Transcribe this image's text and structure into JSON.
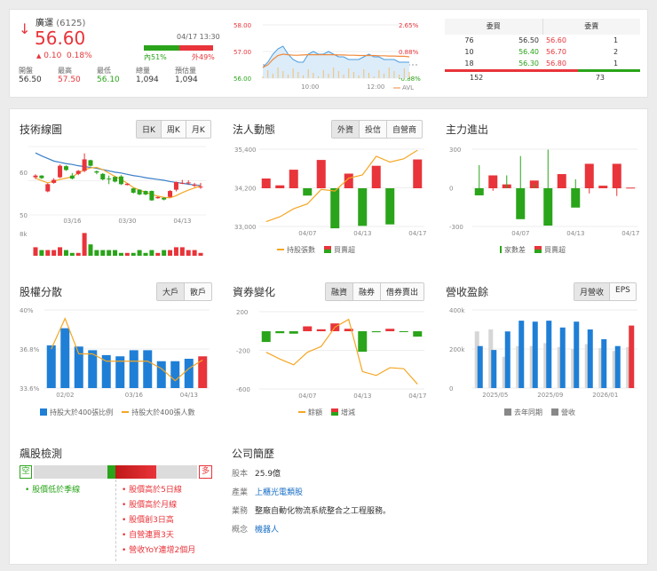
{
  "quote": {
    "name": "廣運",
    "code": "(6125)",
    "price": "56.60",
    "change": "0.10",
    "change_pct": "0.18%",
    "time": "04/17 13:30",
    "inner": "內51%",
    "outer": "外49%",
    "inner_frac": 0.51,
    "stats": [
      {
        "label": "開盤",
        "value": "56.50",
        "color": "#333"
      },
      {
        "label": "最高",
        "value": "57.50",
        "color": "#e8343a"
      },
      {
        "label": "最低",
        "value": "56.10",
        "color": "#2aa41a"
      },
      {
        "label": "總量",
        "value": "1,094",
        "color": "#333"
      },
      {
        "label": "預估量",
        "value": "1,094",
        "color": "#333"
      }
    ]
  },
  "intraday": {
    "y_left": [
      "58.00",
      "57.00",
      "56.00"
    ],
    "y_right": [
      "2.65%",
      "0.88%",
      "-0.88%"
    ],
    "x": [
      "10:00",
      "12:00"
    ],
    "legend": "AVL",
    "price": [
      56.4,
      56.6,
      56.9,
      57.1,
      57.2,
      56.9,
      56.7,
      56.6,
      56.6,
      56.9,
      57.0,
      56.9,
      56.9,
      57.0,
      56.9,
      56.8,
      56.8,
      56.7,
      56.7,
      56.7,
      56.8,
      56.9,
      56.8,
      56.8,
      56.7,
      56.7,
      56.7,
      56.6,
      56.6,
      56.6
    ],
    "avg": [
      56.4,
      56.5,
      56.7,
      56.85,
      56.9,
      56.88,
      56.86,
      56.86,
      56.87,
      56.88,
      56.88,
      56.88,
      56.88,
      56.88,
      56.88,
      56.87,
      56.87,
      56.86,
      56.86,
      56.85,
      56.85,
      56.85,
      56.85,
      56.84,
      56.84,
      56.83,
      56.83,
      56.82,
      56.82,
      56.8
    ]
  },
  "orderbook": {
    "bid_header": "委買",
    "ask_header": "委賣",
    "rows": [
      {
        "bid_vol": "76",
        "bid": "56.50",
        "ask": "56.60",
        "ask_vol": "1"
      },
      {
        "bid_vol": "10",
        "bid": "56.40",
        "ask": "56.70",
        "ask_vol": "2"
      },
      {
        "bid_vol": "18",
        "bid": "56.30",
        "ask": "56.80",
        "ask_vol": "1"
      }
    ],
    "bid_total": "152",
    "ask_total": "73",
    "bid_frac": 0.68
  },
  "tech": {
    "title": "技術線圖",
    "tabs": [
      "日K",
      "周K",
      "月K"
    ],
    "y_labels": [
      "60",
      "50"
    ],
    "x_labels": [
      "03/16",
      "03/30",
      "04/13"
    ],
    "vol_label": "8k",
    "candles": [
      [
        58.8,
        59.2,
        59.5,
        58.4
      ],
      [
        59.2,
        58.6,
        59.3,
        58.4
      ],
      [
        55.5,
        57.2,
        57.4,
        55.3
      ],
      [
        57.5,
        58.2,
        58.6,
        57.3
      ],
      [
        58.8,
        61.5,
        61.8,
        58.6
      ],
      [
        61.4,
        60.5,
        61.6,
        60.3
      ],
      [
        59.2,
        58.5,
        59.8,
        58.3
      ],
      [
        59.6,
        60.3,
        60.5,
        59.3
      ],
      [
        60.3,
        63.0,
        64.4,
        60.0
      ],
      [
        62.8,
        61.5,
        62.9,
        61.3
      ],
      [
        60.2,
        59.9,
        60.4,
        59.5
      ],
      [
        59.6,
        58.3,
        59.8,
        58.1
      ],
      [
        58.5,
        58.4,
        59.2,
        57.2
      ],
      [
        58.9,
        57.8,
        59.0,
        57.6
      ],
      [
        59.0,
        57.2,
        59.3,
        57.0
      ],
      [
        57.0,
        57.3,
        57.4,
        56.9
      ],
      [
        56.2,
        55.2,
        56.3,
        55.0
      ],
      [
        55.9,
        54.8,
        56.0,
        54.6
      ],
      [
        55.6,
        54.8,
        55.7,
        54.6
      ],
      [
        55.6,
        53.4,
        55.7,
        53.3
      ],
      [
        53.9,
        54.2,
        54.3,
        53.8
      ],
      [
        54.0,
        53.6,
        54.1,
        53.4
      ],
      [
        54.2,
        55.6,
        55.8,
        54.1
      ],
      [
        55.9,
        57.7,
        57.8,
        55.5
      ],
      [
        57.4,
        57.5,
        58.2,
        57.2
      ],
      [
        57.5,
        57.6,
        58.1,
        57.0
      ],
      [
        56.8,
        57.1,
        57.5,
        56.5
      ],
      [
        56.5,
        56.6,
        57.5,
        56.1
      ]
    ],
    "ma_long": [
      64.5,
      63.8,
      63.2,
      62.6,
      62.3,
      62.0,
      61.8,
      61.5,
      61.3,
      61.1,
      60.9,
      60.6,
      60.3,
      60.0,
      59.8,
      59.5,
      59.2,
      59.0,
      58.7,
      58.5,
      58.3,
      58.1,
      57.8,
      57.6,
      57.4,
      57.2,
      57.0,
      56.9
    ],
    "ma_short": [
      58.6,
      58.0,
      57.5,
      57.9,
      58.3,
      58.6,
      58.9,
      59.8,
      60.5,
      61.0,
      61.1,
      60.6,
      59.8,
      59.0,
      58.3,
      57.4,
      56.4,
      55.8,
      55.3,
      54.8,
      54.4,
      54.1,
      54.0,
      54.5,
      55.2,
      55.8,
      56.3,
      56.8
    ],
    "volume": [
      3,
      2,
      2,
      2,
      3,
      2,
      1,
      1,
      8,
      4,
      2,
      2,
      2,
      2,
      1,
      1,
      1,
      2,
      1,
      2,
      1,
      2,
      2,
      3,
      3,
      2,
      2,
      1
    ]
  },
  "inst": {
    "title": "法人動態",
    "tabs": [
      "外資",
      "投信",
      "自營商"
    ],
    "y_labels": [
      "35,400",
      "34,200",
      "33,000"
    ],
    "x_labels": [
      "04/07",
      "04/13",
      "04/17"
    ],
    "legend": [
      "持股張數",
      "買賣超"
    ],
    "bars": [
      200,
      60,
      380,
      -150,
      580,
      -820,
      300,
      -770,
      460,
      -740,
      0,
      590
    ],
    "line": [
      33150,
      33300,
      33550,
      33700,
      34150,
      34100,
      34500,
      34600,
      35180,
      35000,
      35100,
      35370
    ]
  },
  "main": {
    "title": "主力進出",
    "y_labels": [
      "300",
      "0",
      "-300"
    ],
    "x_labels": [
      "04/07",
      "04/13",
      "04/17"
    ],
    "legend": [
      "家數差",
      "買賣超"
    ],
    "bars": [
      -55,
      100,
      30,
      -240,
      60,
      -290,
      110,
      -150,
      190,
      20,
      190,
      5
    ],
    "diff": [
      180,
      -20,
      100,
      250,
      30,
      300,
      0,
      70,
      -40,
      0,
      -60,
      0
    ]
  },
  "dist": {
    "title": "股權分散",
    "tabs": [
      "大戶",
      "散戶"
    ],
    "y_labels": [
      "40%",
      "36.8%",
      "33.6%"
    ],
    "x_labels": [
      "02/02",
      "03/16",
      "04/13"
    ],
    "legend": [
      "持股大於400張比例",
      "持股大於400張人數"
    ],
    "bars": [
      37.1,
      38.5,
      37.0,
      36.7,
      36.3,
      36.2,
      36.7,
      36.7,
      35.8,
      35.8,
      36.0,
      36.2
    ],
    "line": [
      36.8,
      39.3,
      36.4,
      36.4,
      35.8,
      35.8,
      35.8,
      35.8,
      35.2,
      34.2,
      35.2,
      35.9
    ]
  },
  "margin": {
    "title": "資券變化",
    "tabs": [
      "融資",
      "融券",
      "借券賣出"
    ],
    "y_labels": [
      "200",
      "-200",
      "-600"
    ],
    "x_labels": [
      "04/07",
      "04/13",
      "04/17"
    ],
    "legend": [
      "餘額",
      "增減"
    ],
    "bars": [
      -110,
      -20,
      -25,
      50,
      20,
      80,
      25,
      -210,
      -10,
      25,
      -5,
      -55
    ],
    "line": [
      -220,
      -290,
      -350,
      -220,
      -160,
      40,
      120,
      -420,
      -460,
      -380,
      -390,
      -550
    ]
  },
  "rev": {
    "title": "營收盈餘",
    "tabs": [
      "月營收",
      "EPS"
    ],
    "y_labels": [
      "400k",
      "200k",
      "0"
    ],
    "x_labels": [
      "2025/05",
      "2025/09",
      "2026/01"
    ],
    "legend": [
      "去年同期",
      "營收"
    ],
    "last_year": [
      290,
      300,
      160,
      215,
      215,
      230,
      210,
      200,
      225,
      205,
      190,
      210
    ],
    "revenue": [
      215,
      195,
      290,
      345,
      340,
      345,
      310,
      340,
      300,
      250,
      215,
      320
    ]
  },
  "detect": {
    "title": "飆股檢測",
    "short": "空",
    "long": "多",
    "bull_frac": 0.55,
    "bear_items": [
      "股價低於季線"
    ],
    "bull_items": [
      "股價高於5日線",
      "股價高於月線",
      "股價創3日高",
      "自營連買3天",
      "營收YoY連增2個月"
    ]
  },
  "profile": {
    "title": "公司簡歷",
    "rows": [
      {
        "label": "股本",
        "value": "25.9億",
        "link": false
      },
      {
        "label": "產業",
        "value": "上櫃光電類股",
        "link": true
      },
      {
        "label": "業務",
        "value": "整廠自動化物流系統整合之工程服務。",
        "link": false
      },
      {
        "label": "概念",
        "value": "機器人",
        "link": true
      }
    ]
  },
  "colors": {
    "red": "#e8343a",
    "green": "#2aa41a",
    "blue": "#1f7fd6",
    "orange": "#f5a623",
    "gray": "#cfcfcf"
  }
}
